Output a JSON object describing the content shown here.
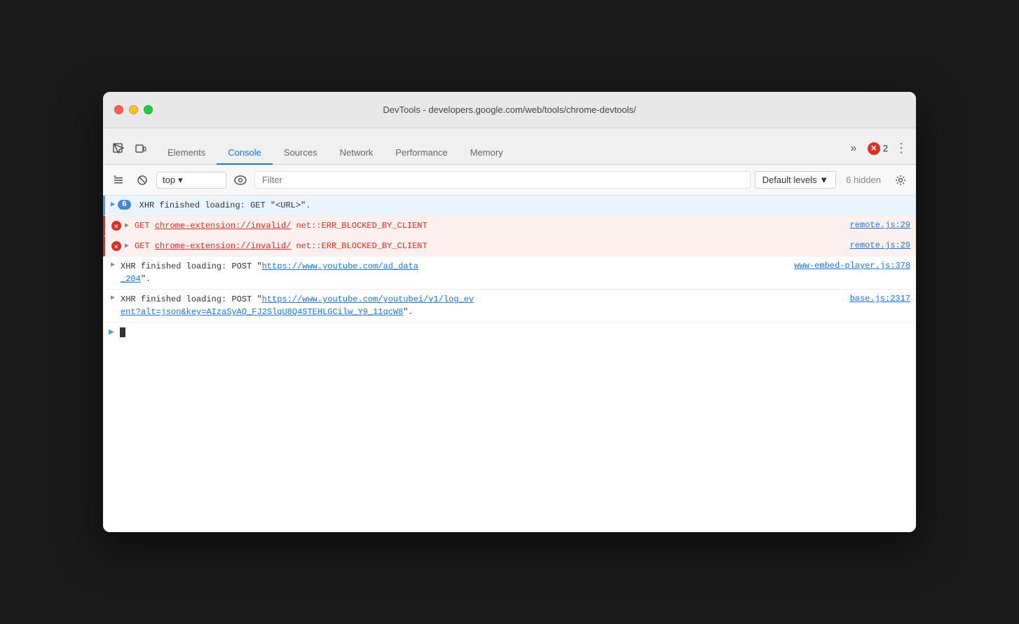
{
  "window": {
    "title": "DevTools - developers.google.com/web/tools/chrome-devtools/"
  },
  "tabs": [
    {
      "id": "elements",
      "label": "Elements",
      "active": false
    },
    {
      "id": "console",
      "label": "Console",
      "active": true
    },
    {
      "id": "sources",
      "label": "Sources",
      "active": false
    },
    {
      "id": "network",
      "label": "Network",
      "active": false
    },
    {
      "id": "performance",
      "label": "Performance",
      "active": false
    },
    {
      "id": "memory",
      "label": "Memory",
      "active": false
    }
  ],
  "error_badge": {
    "count": "2"
  },
  "console_toolbar": {
    "context": "top",
    "filter_placeholder": "Filter",
    "levels_label": "Default levels ▼",
    "hidden_label": "6 hidden"
  },
  "log_entries": [
    {
      "type": "info",
      "badge": "6",
      "text": "XHR finished loading: GET \"<URL>\".",
      "source": ""
    },
    {
      "type": "error",
      "text_get": "GET",
      "text_url": "chrome-extension://invalid/",
      "text_error": "net::ERR_BLOCKED_BY_CLIENT",
      "source": "remote.js:29"
    },
    {
      "type": "error",
      "text_get": "GET",
      "text_url": "chrome-extension://invalid/",
      "text_error": "net::ERR_BLOCKED_BY_CLIENT",
      "source": "remote.js:29"
    },
    {
      "type": "normal",
      "text_pre": "XHR finished loading: POST \"",
      "text_url": "https://www.youtube.com/ad_data",
      "text_post": "_204\".",
      "source": "www-embed-player.js:378"
    },
    {
      "type": "normal",
      "text_pre": "XHR finished loading: POST \"",
      "text_url": "https://www.youtube.com/youtubei/v1/log_ev",
      "text_post_line1": "ent?alt=json&key=AIzaSyAO_FJ2SlqU8Q4STEHLGCilw_Y9_11qcW8\".",
      "source": "base.js:2317"
    }
  ]
}
